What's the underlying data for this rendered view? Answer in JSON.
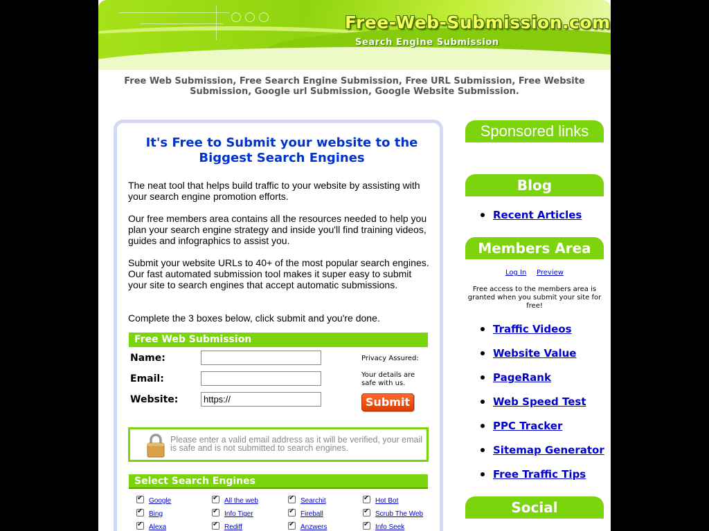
{
  "banner": {
    "site_title": "Free-Web-Submission.com",
    "site_subtitle": "Search Engine Submission"
  },
  "tagline": "Free Web Submission, Free Search Engine Submission, Free URL Submission, Free Website Submission, Google url Submission, Google Website Submission.",
  "main": {
    "heading": "It's Free to Submit your website to the Biggest Search Engines",
    "paragraphs": [
      "The neat tool that helps build traffic to your website by assisting with your search engine promotion efforts.",
      "Our free members area contains all the resources needed to help you plan your search engine strategy and inside you'll find training videos, guides and infographics to assist you.",
      "Submit your website URLs to 40+ of the most popular search engines. Our fast automated submission tool makes it super easy to submit your site to search engines that accept automatic submissions.",
      "Complete the 3 boxes below, click submit and you're done."
    ],
    "form": {
      "title": "Free Web Submission",
      "name_label": "Name:",
      "email_label": "Email:",
      "website_label": "Website:",
      "name_value": "",
      "email_value": "",
      "website_value": "https://",
      "privacy_note": "Privacy Assured:",
      "details_note": "Your details are safe with us.",
      "submit_label": "Submit"
    },
    "notice": "Please enter a valid email address as it will be verified, your email is safe and is not submitted to search engines.",
    "engines": {
      "title": "Select Search Engines",
      "items": [
        {
          "label": "Google",
          "checked": true
        },
        {
          "label": "All the web",
          "checked": true
        },
        {
          "label": "Searchit",
          "checked": true
        },
        {
          "label": "Hot Bot",
          "checked": true
        },
        {
          "label": "Bing",
          "checked": true
        },
        {
          "label": "Info Tiger",
          "checked": true
        },
        {
          "label": "Fireball",
          "checked": true
        },
        {
          "label": "Scrub The Web",
          "checked": true
        },
        {
          "label": "Alexa",
          "checked": true
        },
        {
          "label": "Rediff",
          "checked": true
        },
        {
          "label": "Anzwers",
          "checked": true
        },
        {
          "label": "Info Seek",
          "checked": true
        }
      ]
    }
  },
  "sidebar": {
    "sponsored": "Sponsored links",
    "blog": {
      "title": "Blog",
      "links": [
        "Recent Articles"
      ]
    },
    "members": {
      "title": "Members Area",
      "login": "Log In",
      "preview": "Preview",
      "note": "Free access to the members area is granted when you submit your site for free!",
      "links": [
        "Traffic Videos",
        "Website Value",
        "PageRank",
        "Web Speed Test",
        "PPC Tracker",
        "Sitemap Generator",
        "Free Traffic Tips"
      ]
    },
    "social": {
      "title": "Social"
    }
  },
  "colors": {
    "accent_green": "#7cd40c",
    "link_blue": "#0000cc",
    "heading_blue": "#0033cc",
    "submit_orange": "#f04a08",
    "panel_border": "#d3d9f4"
  }
}
